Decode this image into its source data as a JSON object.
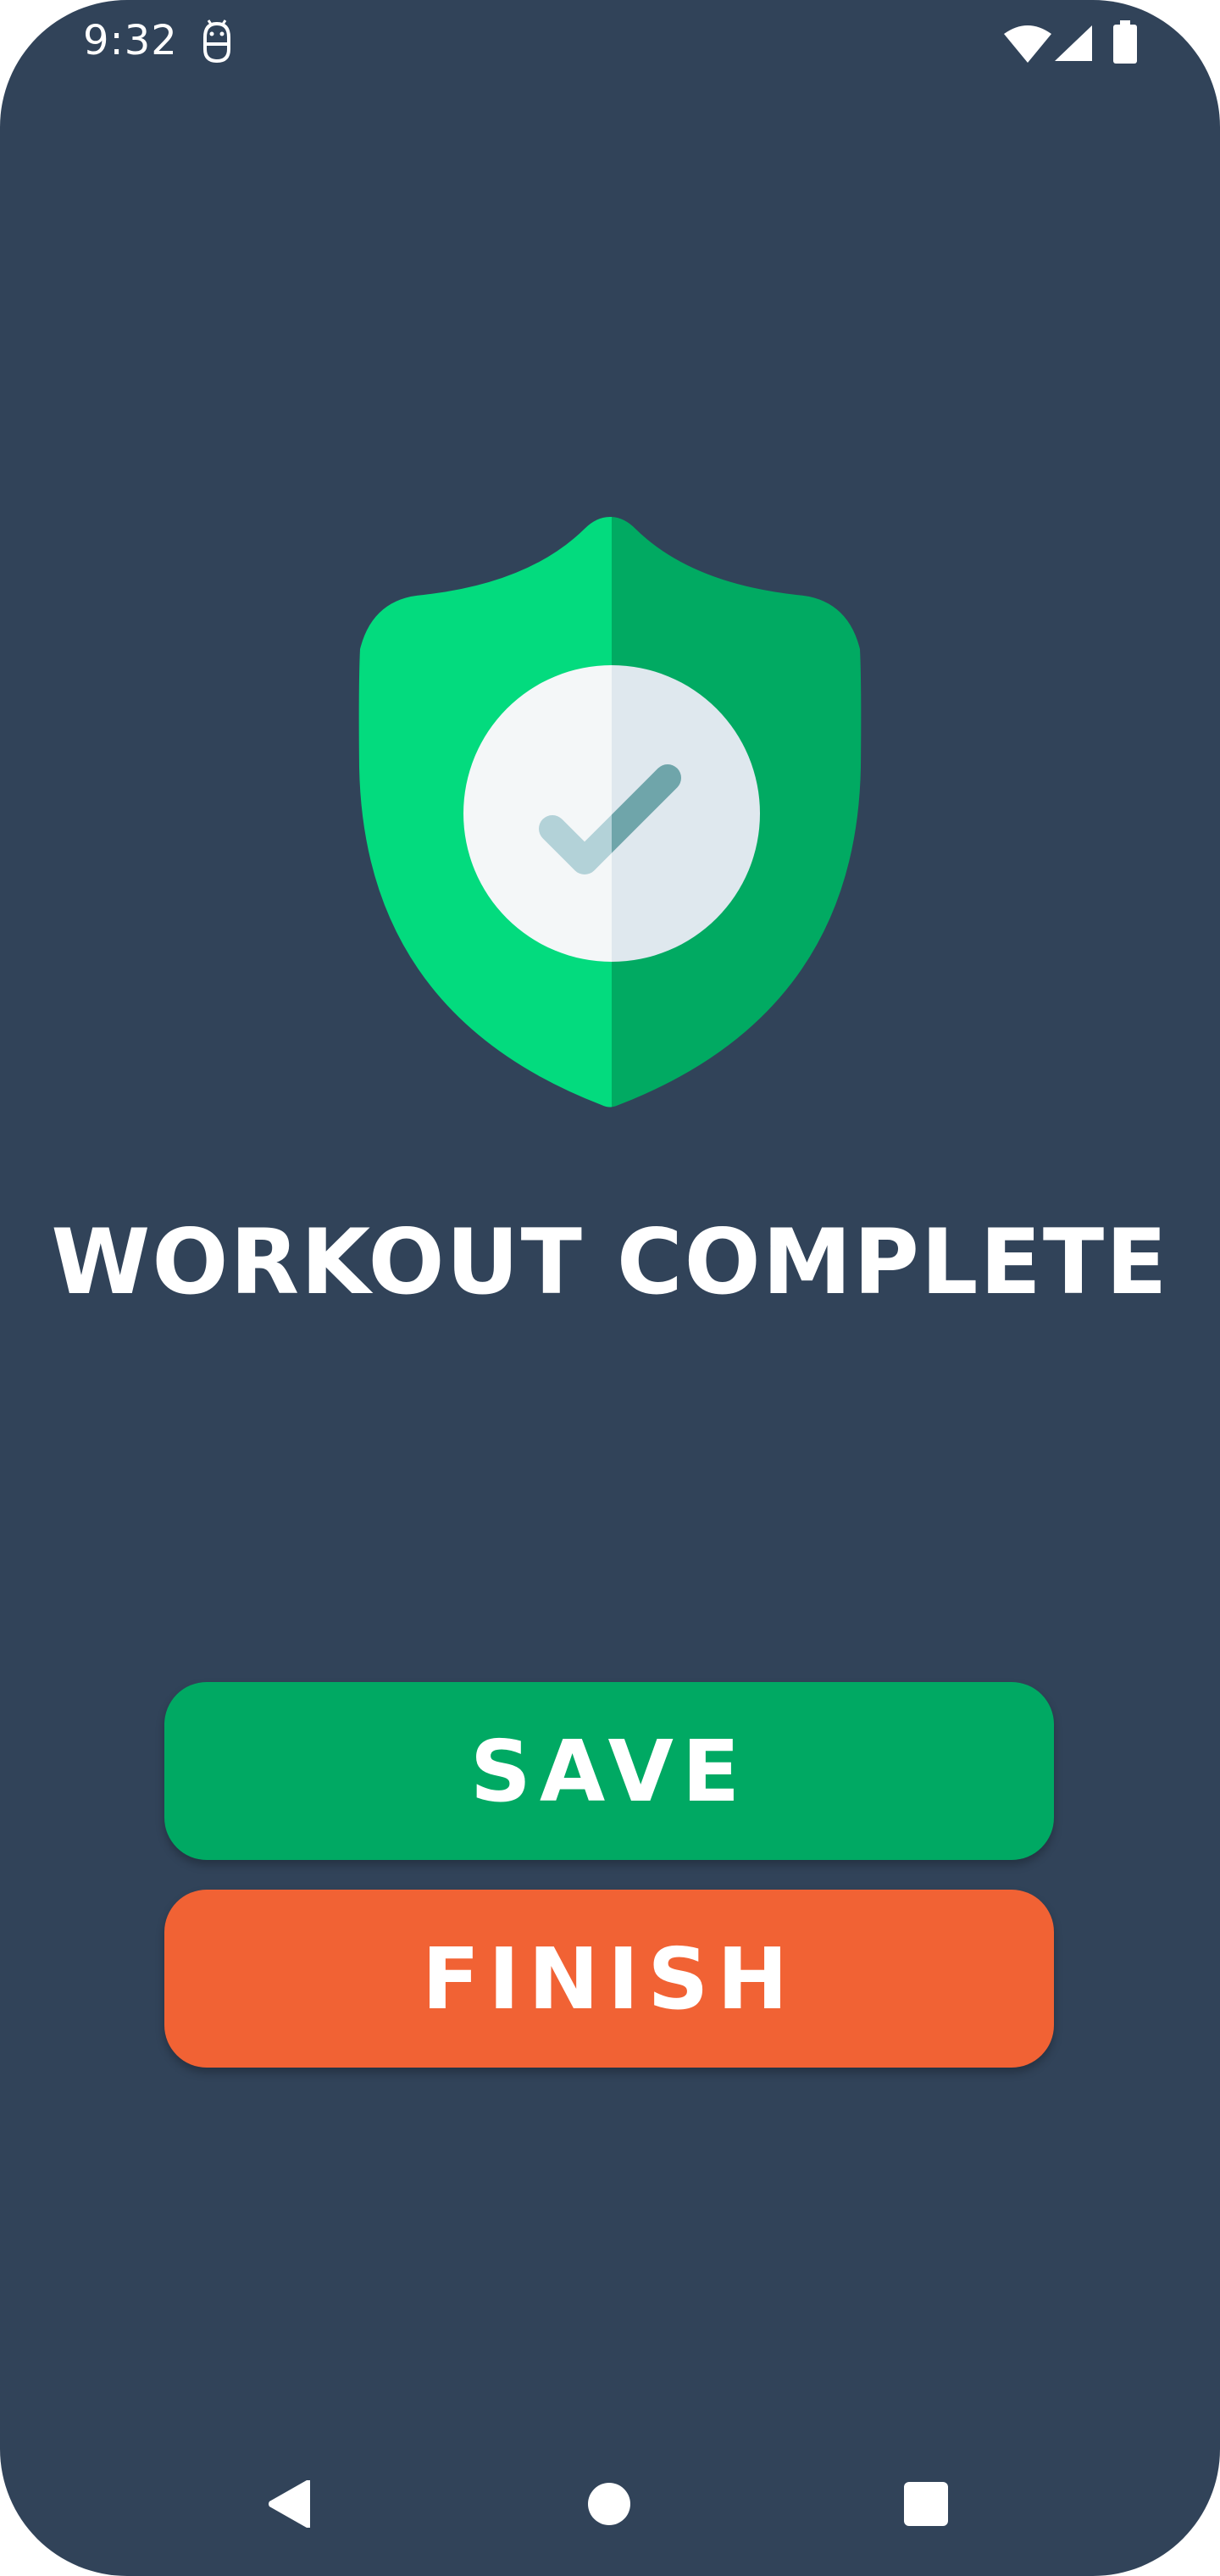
{
  "status_bar": {
    "time": "9:32",
    "app_icon": "bug-face-icon",
    "wifi_icon": "wifi-icon",
    "signal_icon": "cell-signal-icon",
    "battery_icon": "battery-icon"
  },
  "main": {
    "badge_icon": "shield-check-icon",
    "title": "WORKOUT COMPLETE",
    "save_label": "SAVE",
    "finish_label": "FINISH"
  },
  "nav_bar": {
    "back_icon": "back-triangle-icon",
    "home_icon": "home-circle-icon",
    "recents_icon": "recents-square-icon"
  },
  "colors": {
    "background": "#314359",
    "shield_light": "#03db7e",
    "shield_dark": "#01aa62",
    "save_button": "#00a963",
    "finish_button": "#f16234",
    "text": "#ffffff"
  }
}
